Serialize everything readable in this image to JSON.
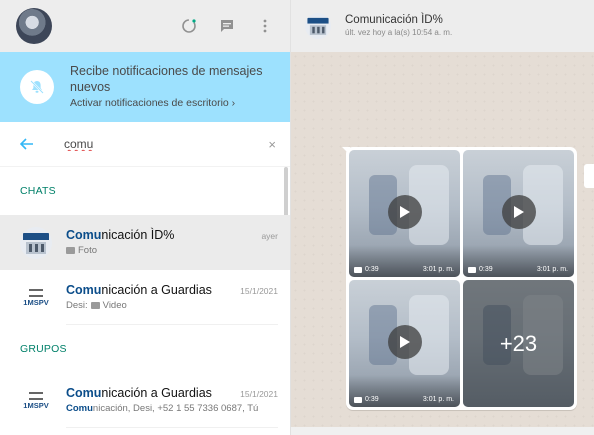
{
  "sidebar": {
    "header": {
      "icons": [
        "avatar",
        "status-icon",
        "new-chat-icon",
        "menu-icon"
      ]
    },
    "notification": {
      "title": "Recibe notificaciones de mensajes nuevos",
      "link": "Activar notificaciones de escritorio ›",
      "icon": "bell-off-icon"
    },
    "search": {
      "value": "comu",
      "clear": "×"
    },
    "sections": {
      "chats": "CHATS",
      "groups": "GRUPOS"
    },
    "chats": [
      {
        "name_match": "Comu",
        "name_rest": "nicación ÌD%",
        "time": "ayer",
        "sub_icon": "photo-icon",
        "sub": "Foto"
      },
      {
        "name_match": "Comu",
        "name_rest": "nicación a Guardias",
        "time": "15/1/2021",
        "sub_prefix": "Desi:",
        "sub_icon": "video-icon",
        "sub": "Video",
        "avatar_text": "1MSPV"
      }
    ],
    "groups": [
      {
        "name_match": "Comu",
        "name_rest": "nicación a Guardias",
        "time": "15/1/2021",
        "sub_match": "Comu",
        "sub_rest": "nicación, Desi, +52 1 55 7336 0687, Tú",
        "avatar_text": "1MSPV"
      }
    ]
  },
  "chat": {
    "name": "Comunicación ÌD%",
    "status": "últ. vez hoy a la(s) 10:54 a. m.",
    "media": [
      {
        "type": "video",
        "duration": "0:39",
        "time": "3:01 p. m."
      },
      {
        "type": "video",
        "duration": "0:39",
        "time": "3:01 p. m."
      },
      {
        "type": "video",
        "duration": "0:39",
        "time": "3:01 p. m."
      },
      {
        "type": "more",
        "count": "+23"
      }
    ]
  },
  "colors": {
    "notification_bg": "#9de1fe",
    "accent": "#33b7f6",
    "section": "#008069",
    "match": "#0b4d8a"
  }
}
